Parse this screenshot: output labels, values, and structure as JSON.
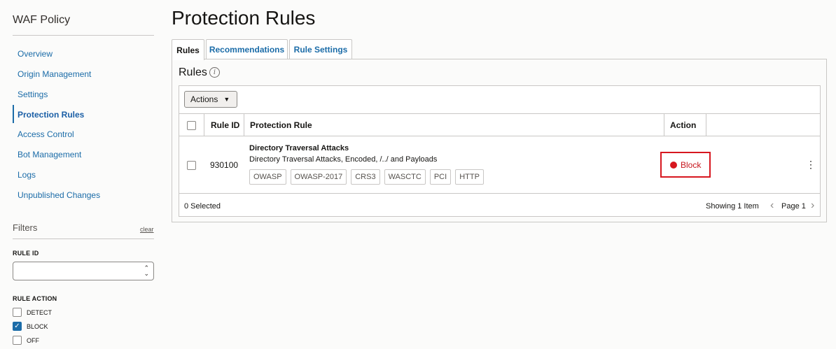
{
  "sidebar": {
    "title": "WAF Policy",
    "items": [
      {
        "label": "Overview"
      },
      {
        "label": "Origin Management"
      },
      {
        "label": "Settings"
      },
      {
        "label": "Protection Rules"
      },
      {
        "label": "Access Control"
      },
      {
        "label": "Bot Management"
      },
      {
        "label": "Logs"
      },
      {
        "label": "Unpublished Changes"
      }
    ],
    "active_item": "Protection Rules",
    "filters": {
      "label": "Filters",
      "clear_label": "clear",
      "rule_id_label": "RULE ID",
      "rule_id_value": "",
      "rule_action_label": "RULE ACTION",
      "options": [
        {
          "label": "DETECT",
          "checked": false
        },
        {
          "label": "BLOCK",
          "checked": true
        },
        {
          "label": "OFF",
          "checked": false
        }
      ]
    }
  },
  "main": {
    "title": "Protection Rules",
    "tabs": [
      {
        "label": "Rules",
        "active": true
      },
      {
        "label": "Recommendations",
        "active": false
      },
      {
        "label": "Rule Settings",
        "active": false
      }
    ],
    "section_heading": "Rules",
    "actions_label": "Actions",
    "columns": [
      "Rule ID",
      "Protection Rule",
      "Action"
    ],
    "rows": [
      {
        "rule_id": "930100",
        "name": "Directory Traversal Attacks",
        "description": "Directory Traversal Attacks, Encoded, /../ and Payloads",
        "tags": [
          "OWASP",
          "OWASP-2017",
          "CRS3",
          "WASCTC",
          "PCI",
          "HTTP"
        ],
        "action": "Block",
        "action_color": "#d7171f"
      }
    ],
    "footer": {
      "selected": "0 Selected",
      "showing": "Showing 1 Item",
      "page": "Page 1"
    }
  },
  "colors": {
    "link": "#1b6ca8",
    "block": "#d7171f"
  }
}
